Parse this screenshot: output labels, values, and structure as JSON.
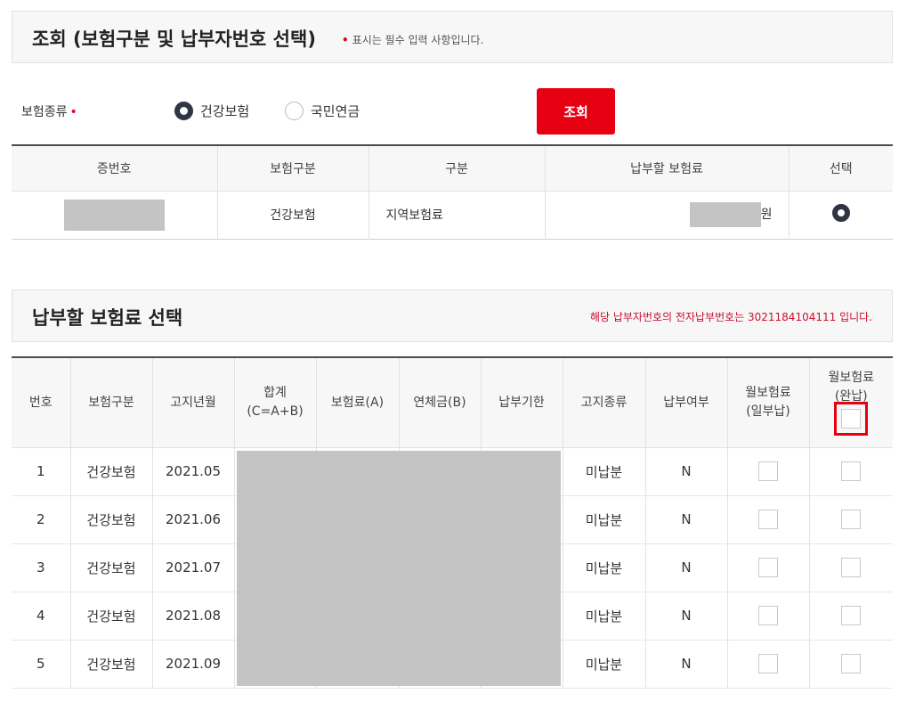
{
  "section1": {
    "title": "조회 (보험구분 및 납부자번호 선택)",
    "required_marker": "•",
    "required_note": "표시는 필수 입력 사항입니다."
  },
  "insurance_type": {
    "label": "보험종류",
    "required_marker": "•",
    "options": [
      {
        "label": "건강보험",
        "selected": true
      },
      {
        "label": "국민연금",
        "selected": false
      }
    ]
  },
  "search_button": "조회",
  "payer_table": {
    "headers": [
      "증번호",
      "보험구분",
      "구분",
      "납부할 보험료",
      "선택"
    ],
    "rows": [
      {
        "cert_no": "",
        "insurance": "건강보험",
        "category": "지역보험료",
        "amount": "",
        "unit": "원",
        "selected": true
      }
    ]
  },
  "section2": {
    "title": "납부할 보험료 선택",
    "notice": "해당 납부자번호의 전자납부번호는 3021184104111 입니다."
  },
  "bill_table": {
    "headers": {
      "no": "번호",
      "insurance": "보험구분",
      "month": "고지년월",
      "total_line1": "합계",
      "total_line2": "(C=A+B)",
      "premium": "보험료(A)",
      "arrears": "연체금(B)",
      "due": "납부기한",
      "notice_type": "고지종류",
      "paid": "납부여부",
      "partial_line1": "월보험료",
      "partial_line2": "(일부납)",
      "full_line1": "월보험료",
      "full_line2": "(완납)"
    },
    "rows": [
      {
        "no": "1",
        "insurance": "건강보험",
        "month": "2021.05",
        "notice_type": "미납분",
        "paid": "N"
      },
      {
        "no": "2",
        "insurance": "건강보험",
        "month": "2021.06",
        "notice_type": "미납분",
        "paid": "N"
      },
      {
        "no": "3",
        "insurance": "건강보험",
        "month": "2021.07",
        "notice_type": "미납분",
        "paid": "N"
      },
      {
        "no": "4",
        "insurance": "건강보험",
        "month": "2021.08",
        "notice_type": "미납분",
        "paid": "N"
      },
      {
        "no": "5",
        "insurance": "건강보험",
        "month": "2021.09",
        "notice_type": "미납분",
        "paid": "N"
      }
    ]
  },
  "colors": {
    "accent_red": "#e60012",
    "header_dark": "#2f3545",
    "notice_red": "#c8102e"
  }
}
